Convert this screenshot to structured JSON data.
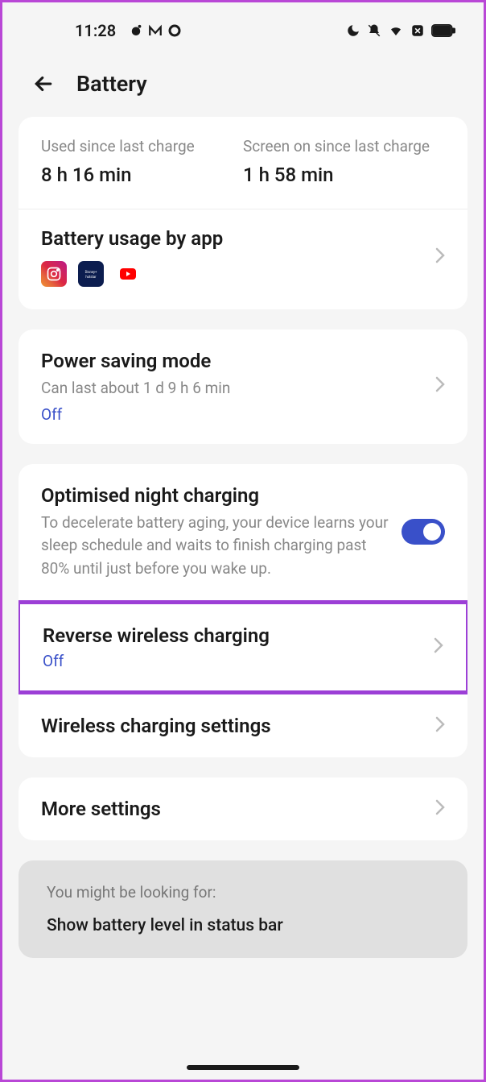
{
  "statusBar": {
    "time": "11:28"
  },
  "header": {
    "title": "Battery"
  },
  "chargeStats": {
    "usedLabel": "Used since last charge",
    "usedValue": "8 h 16 min",
    "screenLabel": "Screen on since last charge",
    "screenValue": "1 h 58 min"
  },
  "batteryUsage": {
    "title": "Battery usage by app"
  },
  "powerSaving": {
    "title": "Power saving mode",
    "subtitle": "Can last about 1 d 9 h 6 min",
    "status": "Off"
  },
  "nightCharging": {
    "title": "Optimised night charging",
    "subtitle": "To decelerate battery aging, your device learns your sleep schedule and waits to finish charging past 80% until just before you wake up."
  },
  "reverseWireless": {
    "title": "Reverse wireless charging",
    "status": "Off"
  },
  "wirelessSettings": {
    "title": "Wireless charging settings"
  },
  "moreSettings": {
    "title": "More settings"
  },
  "suggestion": {
    "label": "You might be looking for:",
    "text": "Show battery level in status bar"
  }
}
